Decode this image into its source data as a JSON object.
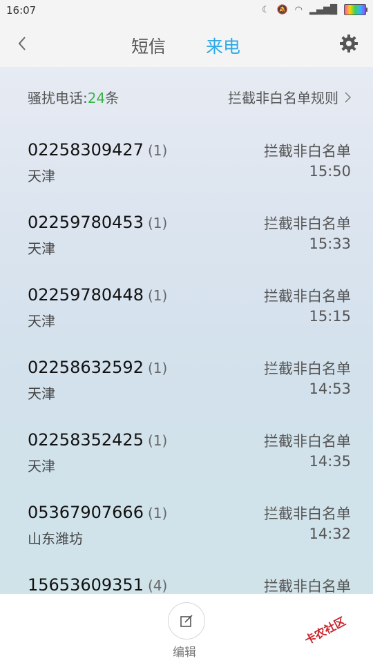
{
  "status": {
    "time": "16:07"
  },
  "header": {
    "tab_sms": "短信",
    "tab_calls": "来电"
  },
  "summary": {
    "label_prefix": "骚扰电话:",
    "count": "24",
    "label_suffix": "条",
    "rule_link": "拦截非白名单规则"
  },
  "calls": [
    {
      "number": "02258309427",
      "count": "(1)",
      "location": "天津",
      "tag": "拦截非白名单",
      "time": "15:50"
    },
    {
      "number": "02259780453",
      "count": "(1)",
      "location": "天津",
      "tag": "拦截非白名单",
      "time": "15:33"
    },
    {
      "number": "02259780448",
      "count": "(1)",
      "location": "天津",
      "tag": "拦截非白名单",
      "time": "15:15"
    },
    {
      "number": "02258632592",
      "count": "(1)",
      "location": "天津",
      "tag": "拦截非白名单",
      "time": "14:53"
    },
    {
      "number": "02258352425",
      "count": "(1)",
      "location": "天津",
      "tag": "拦截非白名单",
      "time": "14:35"
    },
    {
      "number": "05367907666",
      "count": "(1)",
      "location": "山东潍坊",
      "tag": "拦截非白名单",
      "time": "14:32"
    },
    {
      "number": "15653609351",
      "count": "(4)",
      "location": "",
      "tag": "拦截非白名单",
      "time": ""
    }
  ],
  "bottom": {
    "edit_label": "编辑"
  },
  "watermark": "卡农社区",
  "colors": {
    "accent": "#2ea9e6",
    "count": "#39b54a"
  }
}
